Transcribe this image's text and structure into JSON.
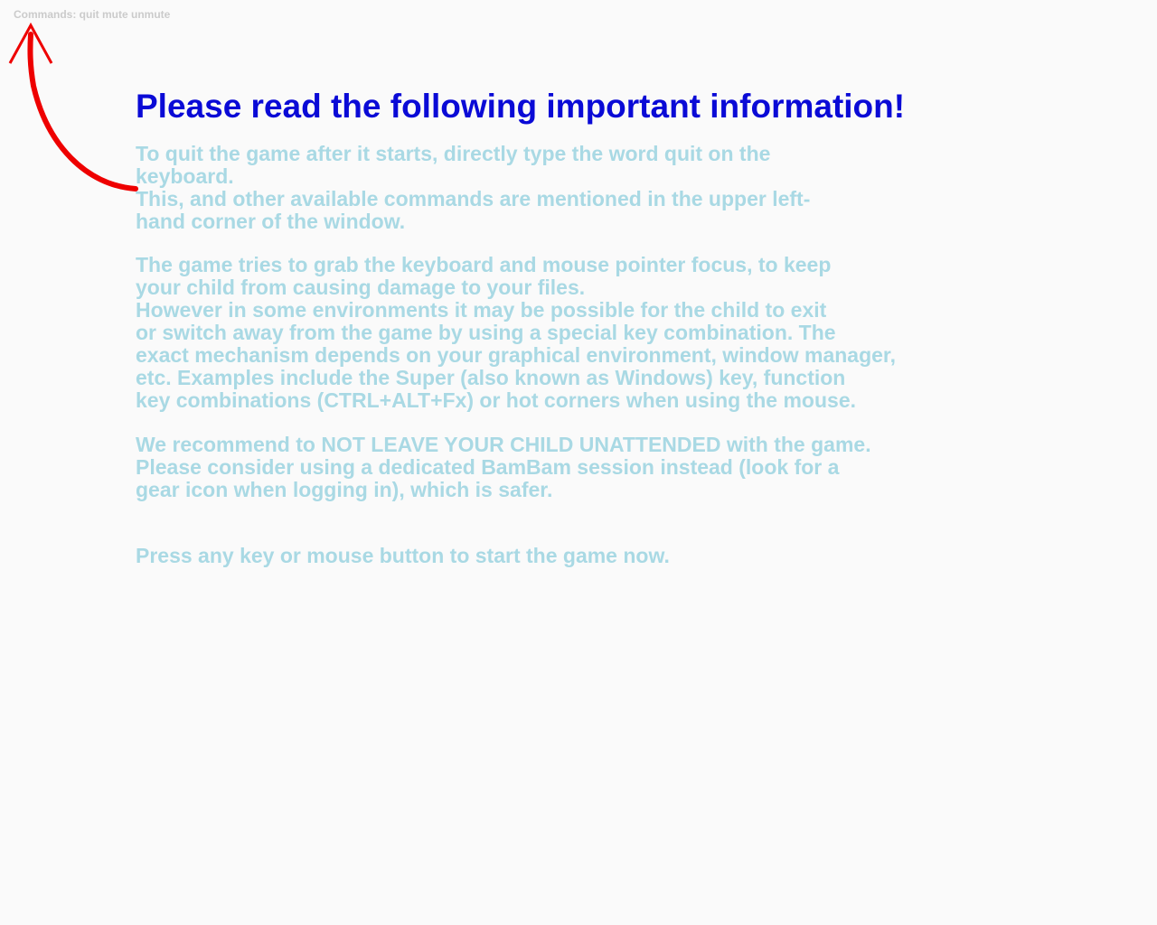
{
  "commands_hint": "Commands: quit mute unmute",
  "title": "Please read the following important information!",
  "paragraphs": {
    "quit": [
      "To quit the game after it starts, directly type the word quit on the",
      "keyboard.",
      "This, and other available commands are mentioned in the upper left-",
      "hand corner of the window."
    ],
    "focus": [
      "The game tries to grab the keyboard and mouse pointer focus, to keep",
      "your child from causing damage to your files.",
      "However in some environments it may be possible for the child to exit",
      "or switch away from the game by using a special key combination. The",
      "exact mechanism depends on your graphical environment, window manager,",
      "etc. Examples include the Super (also known as Windows) key, function",
      "key combinations (CTRL+ALT+Fx) or hot corners when using the mouse."
    ],
    "recommend": [
      "We recommend to NOT LEAVE YOUR CHILD UNATTENDED with the game.",
      "Please consider using a dedicated BamBam session instead (look for a",
      "gear icon when logging in), which is safer."
    ],
    "start": [
      "Press any key or mouse button to start the game now."
    ]
  },
  "colors": {
    "background": "#fafafa",
    "title": "#0a0ad6",
    "body_text": "#a9d9e4",
    "hint_text": "#cbcbcb",
    "arrow": "#ee0000"
  },
  "icons": {
    "pointer": "curved-arrow-up-left-icon"
  }
}
